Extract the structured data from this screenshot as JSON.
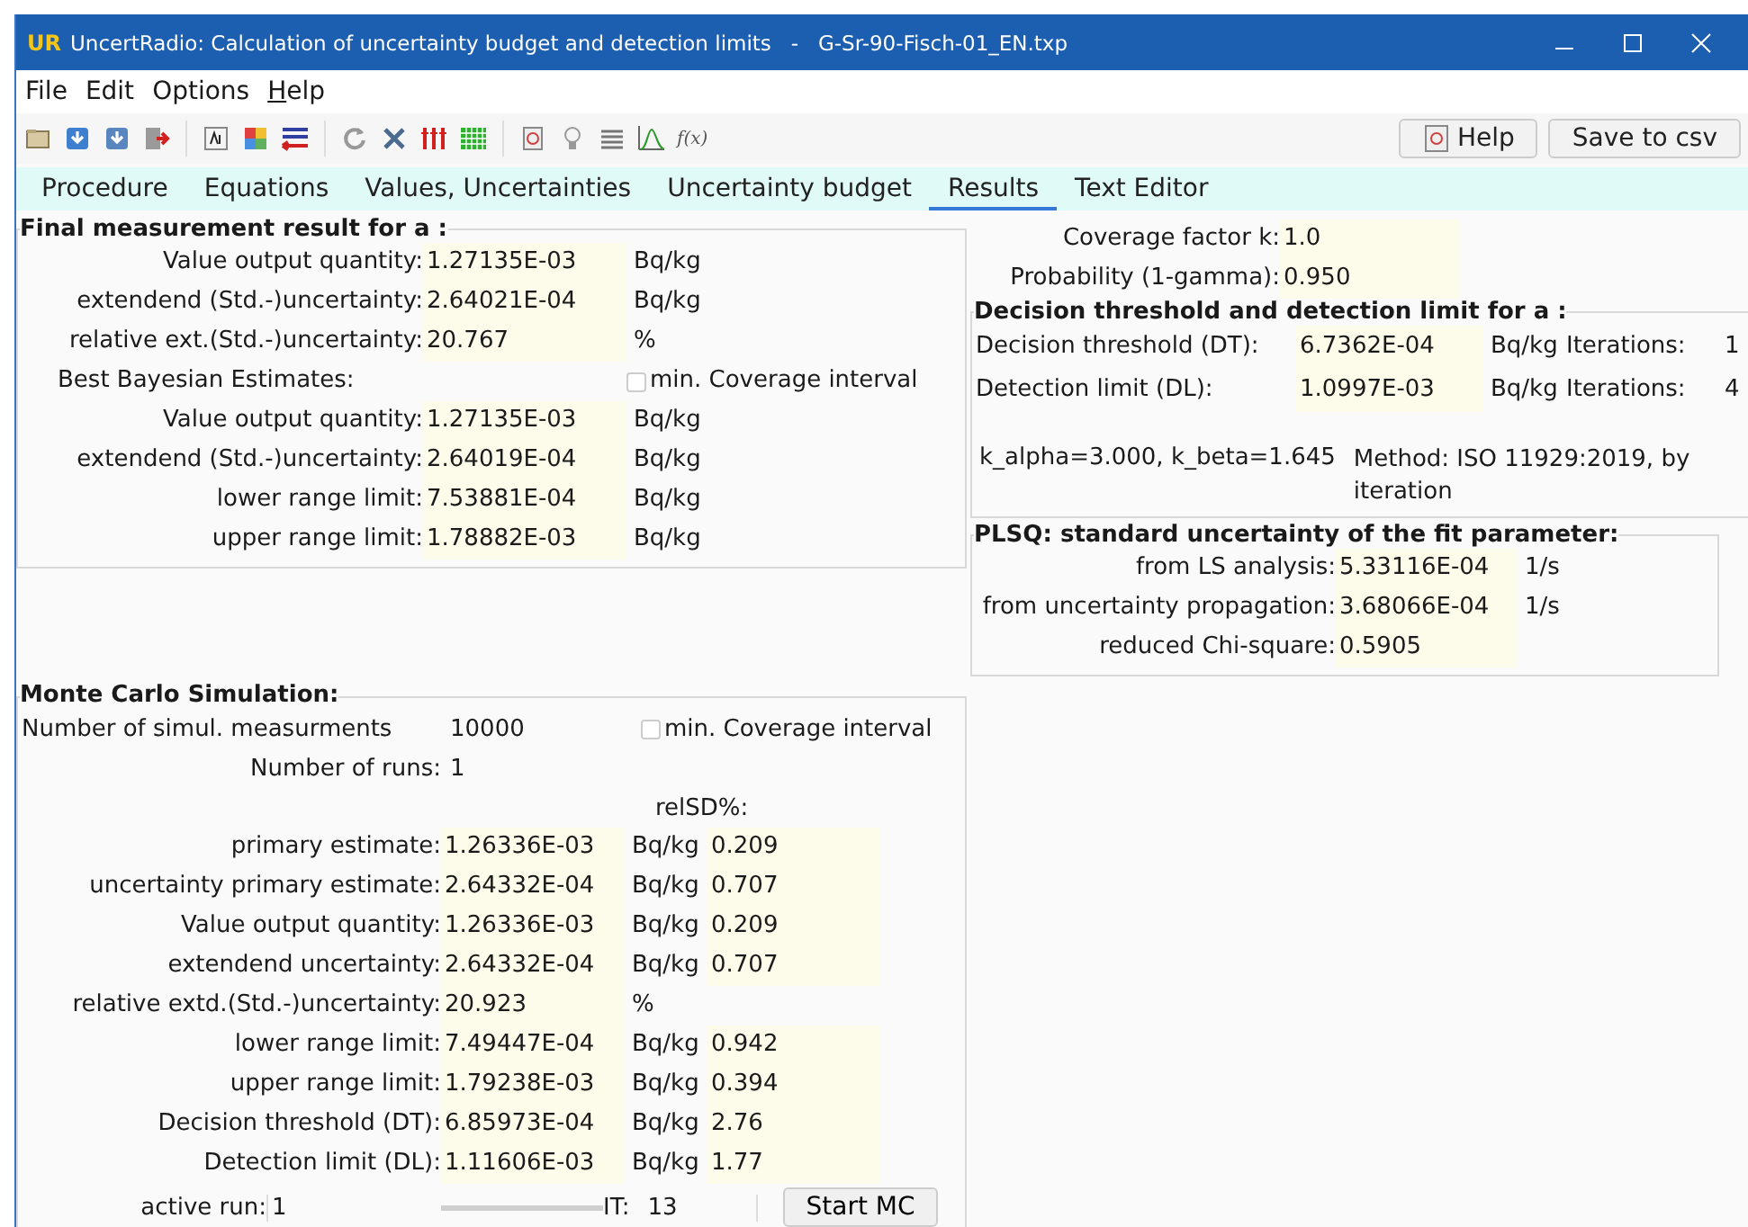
{
  "window": {
    "title": "UncertRadio: Calculation of uncertainty budget and detection limits   -   G-Sr-90-Fisch-01_EN.txp",
    "app_logo": "UR"
  },
  "menu": [
    {
      "label": "File",
      "mnemonic": false
    },
    {
      "label": "Edit",
      "mnemonic": false
    },
    {
      "label": "Options",
      "mnemonic": false
    },
    {
      "label": "Help",
      "mnemonic": true
    }
  ],
  "toolbar": {
    "function_label": "f(x)",
    "buttons": [
      "Help",
      "Save to csv"
    ]
  },
  "tabs": [
    {
      "label": "Procedure",
      "selected": false
    },
    {
      "label": "Equations",
      "selected": false
    },
    {
      "label": "Values, Uncertainties",
      "selected": false
    },
    {
      "label": "Uncertainty budget",
      "selected": false
    },
    {
      "label": "Results",
      "selected": true
    },
    {
      "label": "Text Editor",
      "selected": false
    }
  ],
  "final_result": {
    "title": "Final measurement result for a :",
    "rows": [
      {
        "kind": "value",
        "label": "Value output quantity:",
        "value": "1.27135E-03",
        "unit": "Bq/kg"
      },
      {
        "kind": "value",
        "label": "extendend (Std.-)uncertainty:",
        "value": "2.64021E-04",
        "unit": "Bq/kg"
      },
      {
        "kind": "value",
        "label": "relative ext.(Std.-)uncertainty:",
        "value": "20.767",
        "unit": "%"
      },
      {
        "kind": "heading",
        "label": "Best Bayesian Estimates:",
        "checkbox": {
          "label": "min. Coverage interval",
          "checked": false
        }
      },
      {
        "kind": "value",
        "label": "Value output quantity:",
        "value": "1.27135E-03",
        "unit": "Bq/kg"
      },
      {
        "kind": "value",
        "label": "extendend (Std.-)uncertainty:",
        "value": "2.64019E-04",
        "unit": "Bq/kg"
      },
      {
        "kind": "value",
        "label": "lower range limit:",
        "value": "7.53881E-04",
        "unit": "Bq/kg"
      },
      {
        "kind": "value",
        "label": "upper range limit:",
        "value": "1.78882E-03",
        "unit": "Bq/kg"
      }
    ]
  },
  "coverage": [
    {
      "label": "Coverage factor k:",
      "value": "1.0"
    },
    {
      "label": "Probability (1-gamma):",
      "value": "0.950"
    }
  ],
  "detection": {
    "title": "Decision threshold and detection limit for a :",
    "rows": [
      {
        "label": "Decision threshold (DT):",
        "value": "6.7362E-04",
        "unit": "Bq/kg",
        "iterations_label": "Iterations:",
        "iterations": "1"
      },
      {
        "label": "Detection limit (DL):",
        "value": "1.0997E-03",
        "unit": "Bq/kg",
        "iterations_label": "Iterations:",
        "iterations": "4"
      }
    ],
    "k_values": "k_alpha=3.000,  k_beta=1.645",
    "method": "Method: ISO 11929:2019, by iteration"
  },
  "plsq": {
    "title": "PLSQ: standard uncertainty of the fit parameter:",
    "rows": [
      {
        "label": "from LS analysis:",
        "value": "5.33116E-04",
        "unit": "1/s"
      },
      {
        "label": "from uncertainty propagation:",
        "value": "3.68066E-04",
        "unit": "1/s"
      },
      {
        "label": "reduced Chi-square:",
        "value": "0.5905"
      }
    ]
  },
  "monte_carlo": {
    "title": "Monte Carlo Simulation:",
    "simulations": {
      "label": "Number of simul. measurments",
      "value": "10000"
    },
    "checkbox": {
      "label": "min. Coverage interval",
      "checked": false
    },
    "runs": {
      "label": "Number of runs:",
      "value": "1"
    },
    "relsd_header": "relSD%:",
    "rows": [
      {
        "label": "primary estimate:",
        "value": "1.26336E-03",
        "unit": "Bq/kg",
        "relsd": "0.209"
      },
      {
        "label": "uncertainty primary estimate:",
        "value": "2.64332E-04",
        "unit": "Bq/kg",
        "relsd": "0.707"
      },
      {
        "label": "Value output quantity:",
        "value": "1.26336E-03",
        "unit": "Bq/kg",
        "relsd": "0.209"
      },
      {
        "label": "extendend uncertainty:",
        "value": "2.64332E-04",
        "unit": "Bq/kg",
        "relsd": "0.707"
      },
      {
        "label": "relative extd.(Std.-)uncertainty:",
        "value": "20.923",
        "unit": "%"
      },
      {
        "label": "lower range limit:",
        "value": "7.49447E-04",
        "unit": "Bq/kg",
        "relsd": "0.942"
      },
      {
        "label": "upper range limit:",
        "value": "1.79238E-03",
        "unit": "Bq/kg",
        "relsd": "0.394"
      },
      {
        "label": "Decision threshold (DT):",
        "value": "6.85973E-04",
        "unit": "Bq/kg",
        "relsd": "2.76"
      },
      {
        "label": "Detection limit (DL):",
        "value": "1.11606E-03",
        "unit": "Bq/kg",
        "relsd": "1.77"
      }
    ],
    "active_run": {
      "label": "active run:",
      "value": "1"
    },
    "progress": {
      "level": 1
    },
    "it_label": "IT:",
    "it_value": "13",
    "start_button": "Start MC"
  }
}
